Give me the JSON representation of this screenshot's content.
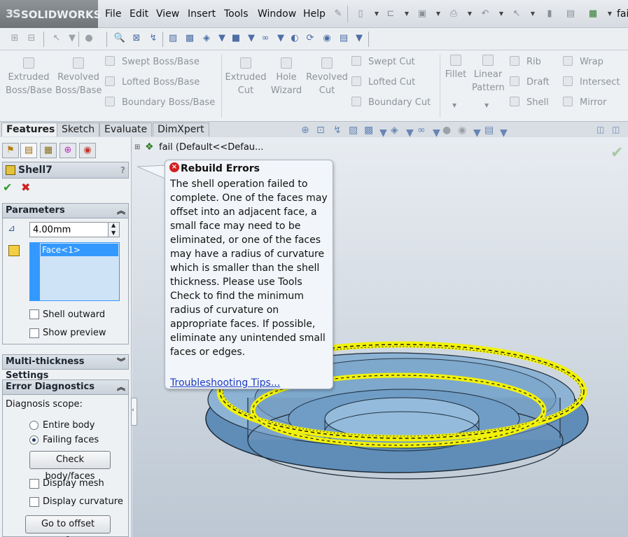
{
  "app": {
    "brand": "SOLIDWORKS",
    "brand_prefix": "3S",
    "title_fragment": "fai"
  },
  "menu": [
    "File",
    "Edit",
    "View",
    "Insert",
    "Tools",
    "Window",
    "Help"
  ],
  "ribbon": {
    "boss": [
      {
        "label": "Extruded",
        "label2": "Boss/Base"
      },
      {
        "label": "Revolved",
        "label2": "Boss/Base"
      }
    ],
    "boss_small": [
      "Swept Boss/Base",
      "Lofted Boss/Base",
      "Boundary Boss/Base"
    ],
    "cut": [
      {
        "label": "Extruded",
        "label2": "Cut"
      },
      {
        "label": "Hole",
        "label2": "Wizard"
      },
      {
        "label": "Revolved",
        "label2": "Cut"
      }
    ],
    "cut_small": [
      "Swept Cut",
      "Lofted Cut",
      "Boundary Cut"
    ],
    "fillet": "Fillet",
    "linear_pattern": {
      "label": "Linear",
      "label2": "Pattern"
    },
    "features_col1": [
      "Rib",
      "Draft",
      "Shell"
    ],
    "features_col2": [
      "Wrap",
      "Intersect",
      "Mirror"
    ]
  },
  "cm_tabs": [
    "Features",
    "Sketch",
    "Evaluate",
    "DimXpert"
  ],
  "tree": {
    "item": "fail  (Default<<Defau..."
  },
  "property_manager": {
    "title": "Shell7",
    "help": "?",
    "parameters": {
      "header": "Parameters",
      "thickness": "4.00mm",
      "faces": [
        "Face<1>"
      ],
      "shell_outward": "Shell outward",
      "show_preview": "Show preview"
    },
    "multi_thickness": {
      "header": "Multi-thickness Settings"
    },
    "error_diagnostics": {
      "header": "Error Diagnostics",
      "scope_label": "Diagnosis scope:",
      "entire_body": "Entire body",
      "failing_faces": "Failing faces",
      "selected_scope": "Failing faces",
      "check_button": "Check body/faces",
      "display_mesh": "Display mesh",
      "display_curvature": "Display curvature",
      "goto_button": "Go to offset surface"
    }
  },
  "tooltip": {
    "title": "Rebuild Errors",
    "message": "The shell operation failed to complete. One of the faces may offset into an adjacent face, a small face may need to be eliminated, or one of the faces may have a radius of curvature which is smaller than the shell thickness. Please use Tools Check to find the minimum radius of curvature on appropriate faces. If possible, eliminate any unintended small faces or edges.",
    "link": "Troubleshooting Tips..."
  },
  "colors": {
    "highlight_yellow": "#f2f20a",
    "part_blue": "#6e9cc4",
    "selection_blue": "#3399ff",
    "error_red": "#d11f1f",
    "ok_green": "#2f9a2f"
  }
}
